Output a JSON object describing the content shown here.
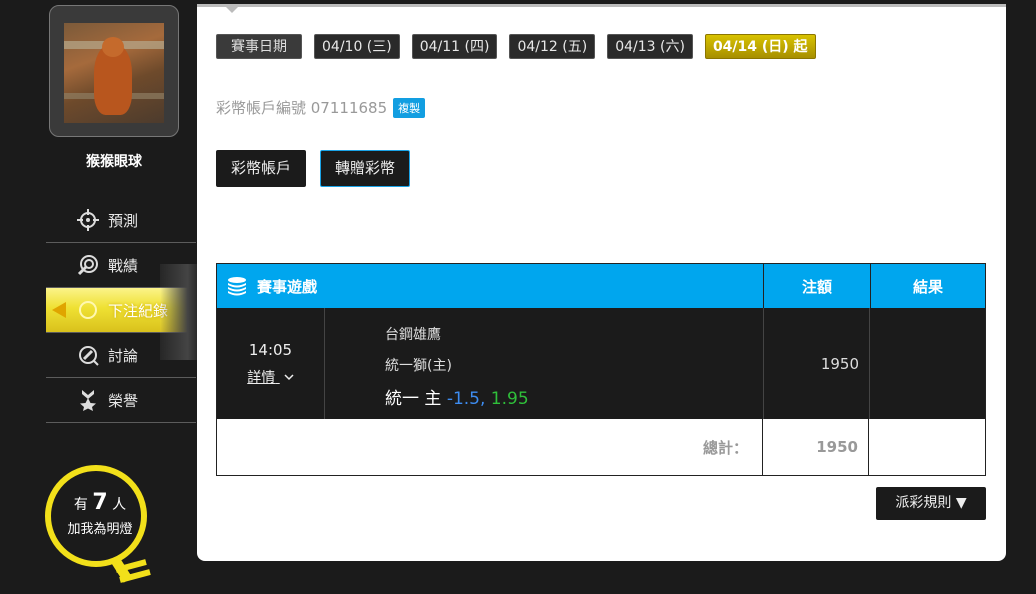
{
  "sidebar": {
    "username": "猴猴眼球",
    "nav": [
      {
        "label": "預測",
        "icon": "crosshair-icon"
      },
      {
        "label": "戰績",
        "icon": "target-hand-icon"
      },
      {
        "label": "下注紀錄",
        "icon": "record-icon"
      },
      {
        "label": "討論",
        "icon": "chat-pen-icon"
      },
      {
        "label": "榮譽",
        "icon": "medal-icon"
      }
    ],
    "fans": {
      "prefix": "有",
      "count": "7",
      "suffix": "人",
      "caption": "加我為明燈"
    }
  },
  "dates": {
    "label": "賽事日期",
    "items": [
      "04/10 (三)",
      "04/11 (四)",
      "04/12 (五)",
      "04/13 (六)",
      "04/14 (日) 起"
    ]
  },
  "account": {
    "text": "彩幣帳戶編號 07111685",
    "copy_label": "複製"
  },
  "buttons": {
    "account": "彩幣帳戶",
    "transfer": "轉贈彩幣"
  },
  "table": {
    "headers": {
      "game": "賽事遊戲",
      "amount": "注額",
      "result": "結果"
    },
    "row": {
      "time": "14:05",
      "detail": "詳情",
      "team_away": "台鋼雄鷹",
      "team_home": "統一獅(主)",
      "pick": "統一 主",
      "line": "-1.5,",
      "odds": "1.95",
      "amount": "1950",
      "result": ""
    },
    "total_label": "總計：",
    "total_amount": "1950"
  },
  "rules_label": "派彩規則 ▼",
  "colors": {
    "header_blue": "#00a6ee",
    "accent_gold": "#d8c200",
    "line_blue": "#3d8cf0",
    "odds_green": "#2fbf3a"
  }
}
